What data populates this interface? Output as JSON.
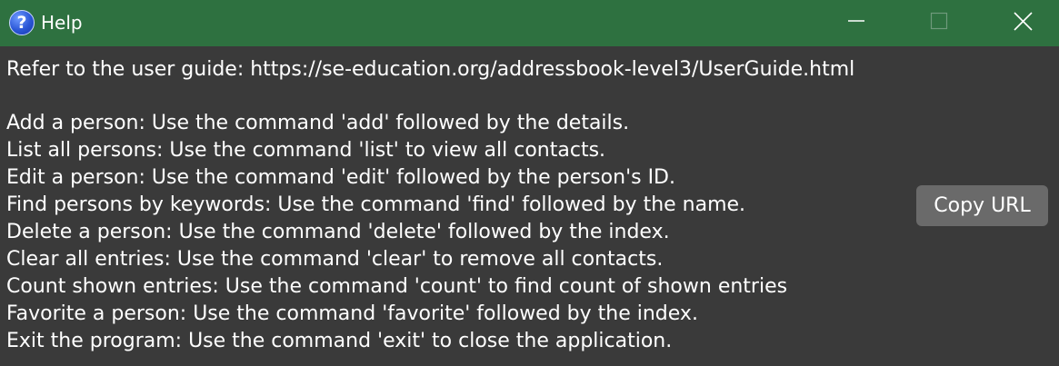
{
  "window": {
    "title": "Help",
    "icon": "help-question-icon",
    "colors": {
      "titlebar": "#2e7140",
      "background": "#3a3a3a",
      "button": "#6a6a6a",
      "text": "#ffffff"
    },
    "controls": [
      "minimize-icon",
      "maximize-icon",
      "close-icon"
    ]
  },
  "help": {
    "user_guide": "Refer to the user guide: https://se-education.org/addressbook-level3/UserGuide.html",
    "commands": [
      "Add a person: Use the command 'add' followed by the details.",
      "List all persons: Use the command 'list' to view all contacts.",
      "Edit a person: Use the command 'edit' followed by the person's ID.",
      "Find persons by keywords: Use the command 'find' followed by the name.",
      "Delete a person: Use the command 'delete' followed by the index.",
      "Clear all entries: Use the command 'clear' to remove all contacts.",
      "Count shown entries: Use the command 'count' to find count of shown entries",
      "Favorite a person: Use the command 'favorite' followed by the index.",
      "Exit the program: Use the command 'exit' to close the application."
    ],
    "copy_button_label": "Copy URL"
  }
}
